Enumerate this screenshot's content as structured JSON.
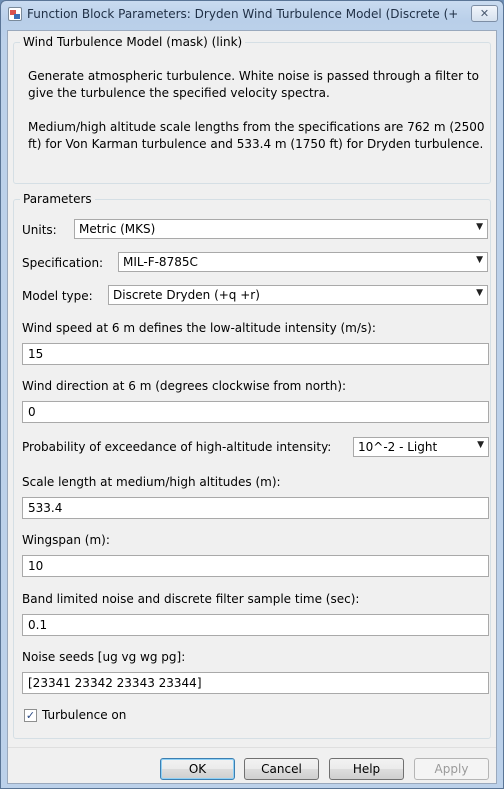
{
  "window": {
    "title": "Function Block Parameters: Dryden Wind Turbulence Model (Discrete (+...",
    "close_glyph": "✕"
  },
  "mask_group": {
    "title": "Wind Turbulence Model (mask) (link)",
    "description_1": "Generate atmospheric turbulence. White noise is passed through a filter to give the turbulence the specified velocity spectra.",
    "description_2": "Medium/high altitude scale lengths from the specifications are 762 m (2500 ft) for Von Karman turbulence and 533.4 m (1750 ft) for Dryden turbulence."
  },
  "parameters": {
    "title": "Parameters",
    "units": {
      "label": "Units:",
      "value": "Metric (MKS)"
    },
    "specification": {
      "label": "Specification:",
      "value": "MIL-F-8785C"
    },
    "model_type": {
      "label": "Model type:",
      "value": "Discrete Dryden (+q +r)"
    },
    "wind_speed": {
      "label": "Wind speed at 6 m defines the low-altitude intensity (m/s):",
      "value": "15"
    },
    "wind_direction": {
      "label": "Wind direction at 6 m (degrees clockwise from north):",
      "value": "0"
    },
    "probability": {
      "label": "Probability of exceedance of high-altitude intensity:",
      "value": "10^-2 - Light"
    },
    "scale_length": {
      "label": "Scale length at medium/high altitudes (m):",
      "value": "533.4"
    },
    "wingspan": {
      "label": "Wingspan (m):",
      "value": "10"
    },
    "sample_time": {
      "label": "Band limited noise and discrete filter sample time (sec):",
      "value": "0.1"
    },
    "noise_seeds": {
      "label": "Noise seeds [ug vg wg pg]:",
      "value": "[23341 23342 23343 23344]"
    },
    "turbulence_on": {
      "label": "Turbulence on",
      "checked": true,
      "check_glyph": "✓"
    }
  },
  "buttons": {
    "ok": "OK",
    "cancel": "Cancel",
    "help": "Help",
    "apply": "Apply"
  },
  "icons": {
    "dropdown_arrow": "▼"
  },
  "colors": {
    "title_bar": "#bcd1ea",
    "dialog_bg": "#f0f0f0",
    "default_button_border": "#3c7fb1"
  }
}
